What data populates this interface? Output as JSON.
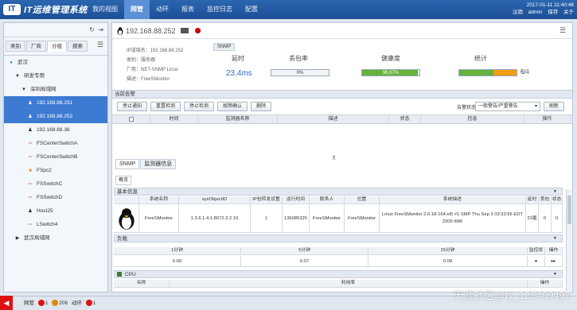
{
  "app": {
    "logo_mark": "IT",
    "title": "IT运维管理系统"
  },
  "nav": [
    {
      "label": "我的视图"
    },
    {
      "label": "网管",
      "active": true
    },
    {
      "label": "动环"
    },
    {
      "label": "报表"
    },
    {
      "label": "监控日志"
    },
    {
      "label": "配置"
    }
  ],
  "topright": {
    "datetime": "2017-01-11 11:40:48",
    "logout": "注销",
    "user": "admin",
    "save": "保存",
    "about": "关于"
  },
  "sidebar": {
    "tabs": [
      "类别",
      "厂商",
      "分组",
      "搜索"
    ],
    "active_tab": "分组",
    "tree": [
      {
        "label": "武汉",
        "level": 0,
        "icon": "location-pin-icon"
      },
      {
        "label": "研发专用",
        "level": 1,
        "icon": "expand-icon"
      },
      {
        "label": "深圳局域网",
        "level": 2,
        "icon": "expand-icon"
      },
      {
        "label": "192.168.88.251",
        "level": 3,
        "icon": "linux-icon",
        "selected": true
      },
      {
        "label": "192.168.88.252",
        "level": 3,
        "icon": "linux-icon",
        "selected": true
      },
      {
        "label": "192.168.88.36",
        "level": 3,
        "icon": "linux-icon"
      },
      {
        "label": "FSCenterSwitchA",
        "level": 3,
        "icon": "switch-icon"
      },
      {
        "label": "FSCenterSwitchB",
        "level": 3,
        "icon": "switch-icon"
      },
      {
        "label": "FSpc2",
        "level": 3,
        "icon": "windows-icon"
      },
      {
        "label": "FSSwitchC",
        "level": 3,
        "icon": "switch-icon"
      },
      {
        "label": "FSSwitchD",
        "level": 3,
        "icon": "switch-icon"
      },
      {
        "label": "Host25",
        "level": 3,
        "icon": "linux-icon"
      },
      {
        "label": "LSwitch4",
        "level": 3,
        "icon": "switch-icon"
      },
      {
        "label": "武汉局域网",
        "level": 1,
        "icon": "collapse-icon"
      }
    ]
  },
  "device": {
    "ip": "192.168.88.252",
    "fields": [
      {
        "label": "IP或域名：",
        "value": "192.168.88.252"
      },
      {
        "label": "类别：",
        "value": "服务器"
      },
      {
        "label": "厂商：",
        "value": "NET-SNMP Linux"
      },
      {
        "label": "描述：",
        "value": "FreeSMonitor"
      }
    ],
    "protocol": "SNMP",
    "latency": {
      "label": "延时",
      "value": "23.4ms"
    },
    "loss": {
      "label": "丢包率",
      "value": "0%",
      "fraction": 0
    },
    "health": {
      "label": "健康度",
      "value": "96.67%",
      "fraction": 0.9667
    },
    "stats": {
      "label": "统计",
      "value": "6/",
      "total": "4",
      "fraction": 0.6
    }
  },
  "alerts": {
    "title": "当前告警",
    "buttons": [
      "停止通知",
      "重置检测",
      "停止检测",
      "故障确认",
      "删除"
    ],
    "status_label": "告警状态：",
    "status_value": "一般警告/严重警告",
    "refresh": "刷新",
    "columns": [
      "",
      "时间",
      "监测器名称",
      "描述",
      "状态",
      "信息",
      "操作"
    ]
  },
  "detail": {
    "tabs": [
      "SNMP",
      "监测器信息"
    ],
    "subtab": "概览",
    "basic": {
      "title": "基本信息",
      "columns": [
        "",
        "系统名称",
        "sysObjectID",
        "IP包转发设置",
        "运行时间",
        "联系人",
        "位置",
        "系统描述",
        "延时",
        "丢包率",
        "状态"
      ],
      "row": {
        "name": "FreeSMonitor",
        "oid": "1.3.6.1.4.1.8072.3.2.10",
        "forward": "1",
        "uptime": "136085325",
        "contact": "FreeSMonitor",
        "location": "FreeSMonitor",
        "desc": "Linux FreeSMonitor 2.6.18-164.el5 #1 SMP Thu Sep 3 03:33:56 EDT 2009 i686",
        "latency": "23毫秒",
        "loss": "0",
        "status": "0"
      }
    },
    "load": {
      "title": "负载",
      "columns": [
        "1分钟",
        "5分钟",
        "15分钟",
        "监控状态",
        "操作"
      ],
      "row": [
        "0.00",
        "0.07",
        "0.08"
      ]
    },
    "cpu": {
      "title": "CPU",
      "columns": [
        "名称",
        "利用率",
        "操作"
      ]
    }
  },
  "bottom": {
    "network": "网管",
    "net_count": "1",
    "env_count": "206",
    "dyn": "动环",
    "dyn_count": "1"
  },
  "watermark": "天涯社区@ty_125409497"
}
